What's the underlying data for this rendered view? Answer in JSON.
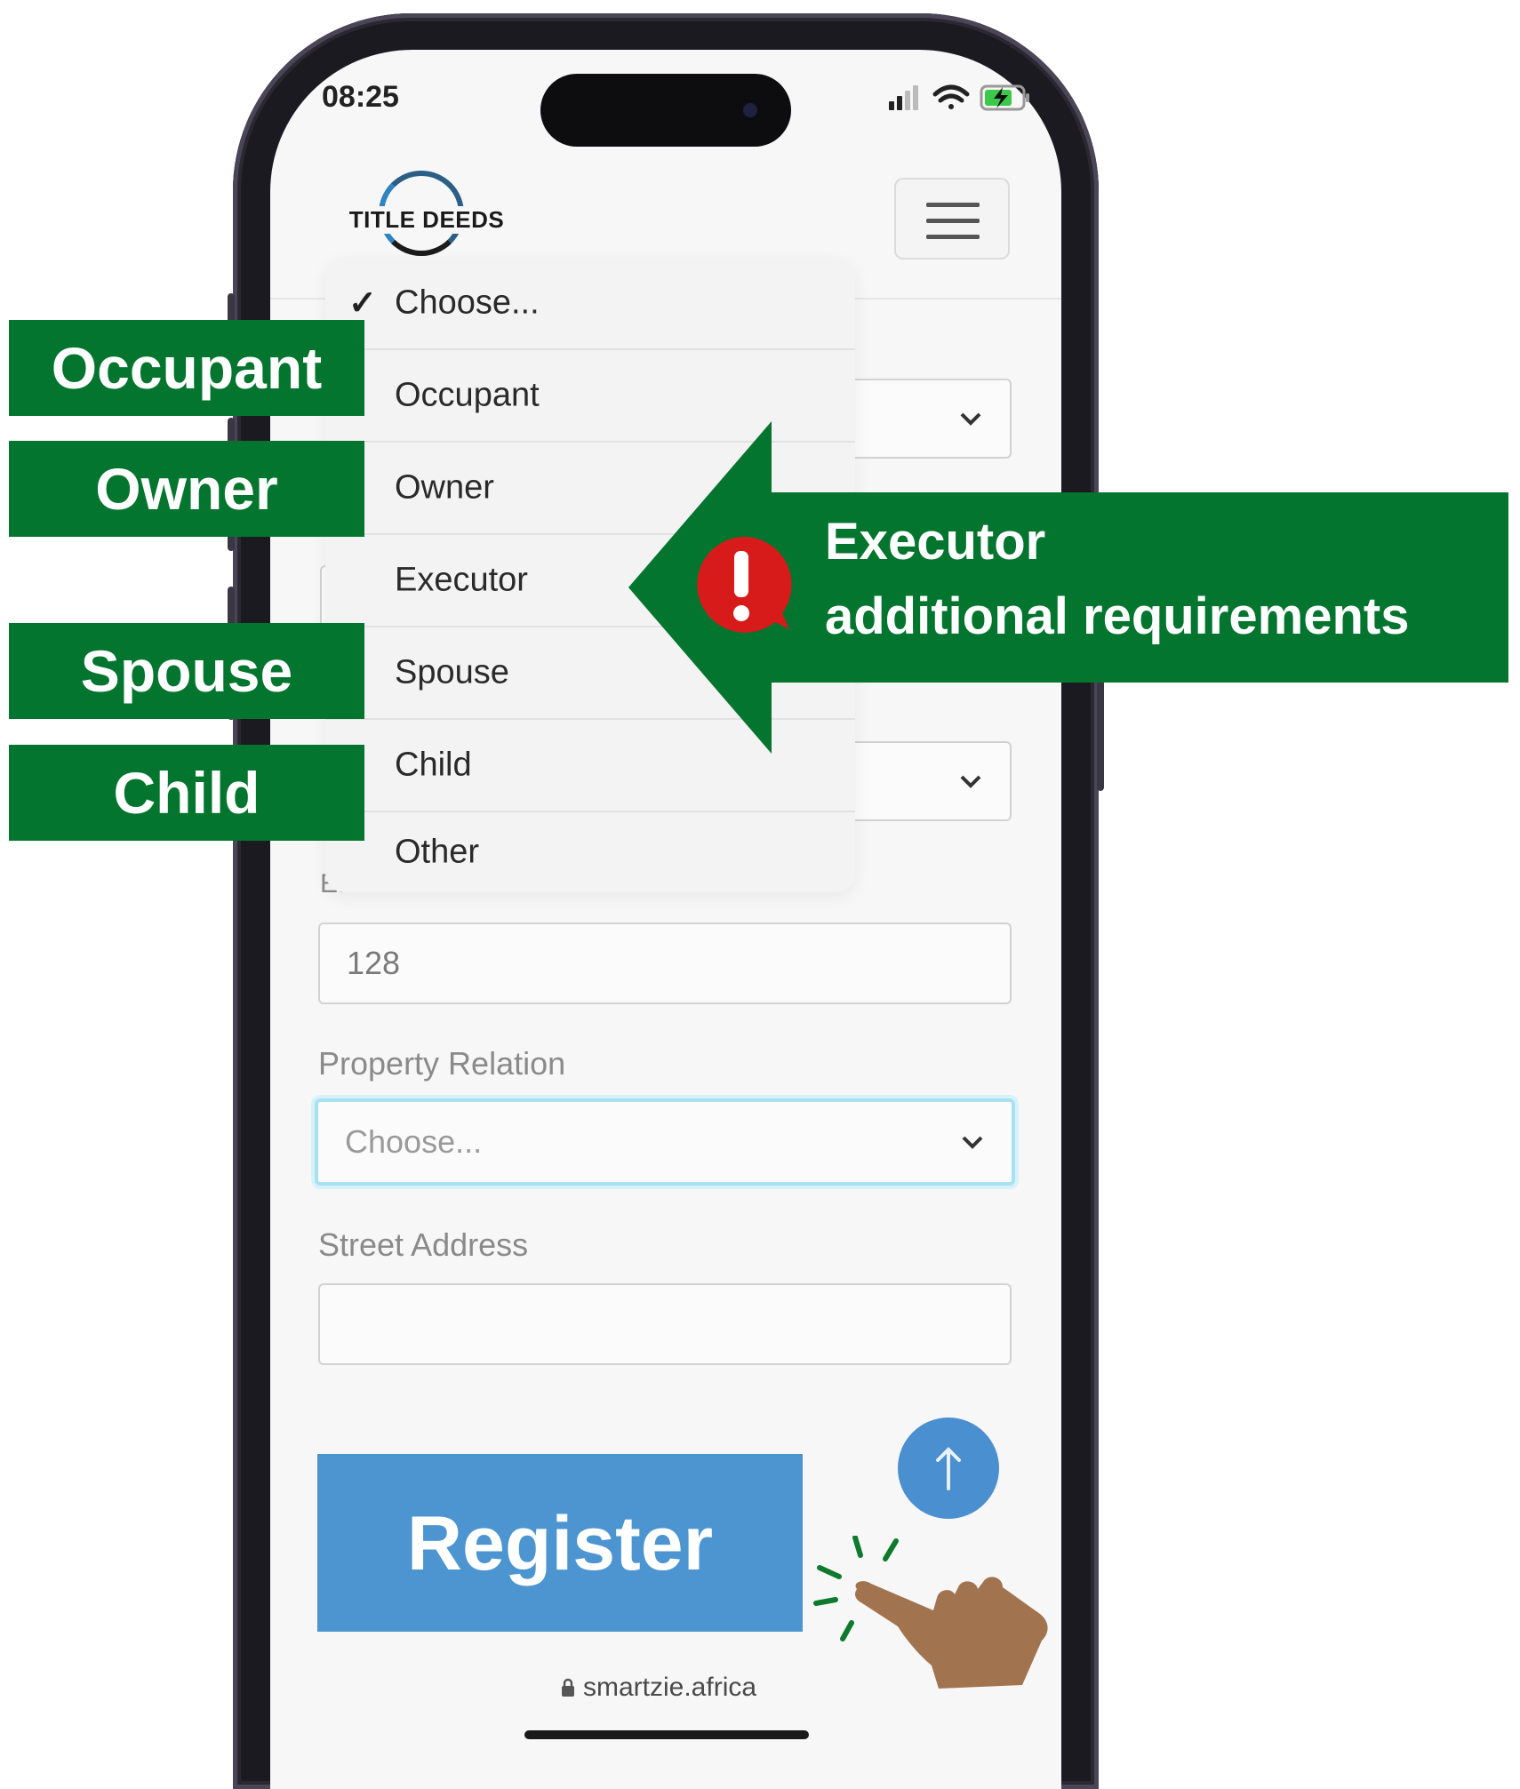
{
  "status_bar": {
    "time": "08:25"
  },
  "header": {
    "logo_text": "TITLE DEEDS"
  },
  "form": {
    "field_value_1": "128",
    "partial_label": "E...",
    "property_relation_label": "Property Relation",
    "property_relation_placeholder": "Choose...",
    "street_address_label": "Street Address",
    "street_address_value": ""
  },
  "dropdown": {
    "selected": "Choose...",
    "options": [
      "Choose...",
      "Occupant",
      "Owner",
      "Executor",
      "Spouse",
      "Child",
      "Other"
    ]
  },
  "callouts": {
    "occupant": "Occupant",
    "owner": "Owner",
    "spouse": "Spouse",
    "child": "Child",
    "executor_line1": "Executor",
    "executor_line2": "additional requirements"
  },
  "footer": {
    "register_label": "Register",
    "url": "smartzie.africa"
  },
  "colors": {
    "callout_green": "#04752f",
    "register_blue": "#4d95d0",
    "warning_red": "#d71a1a"
  },
  "icons": [
    "signal-icon",
    "wifi-icon",
    "battery-icon",
    "menu-icon",
    "chevron-down-icon",
    "checkmark-icon",
    "warning-icon",
    "arrow-up-icon",
    "lock-icon",
    "pointing-hand-icon"
  ]
}
